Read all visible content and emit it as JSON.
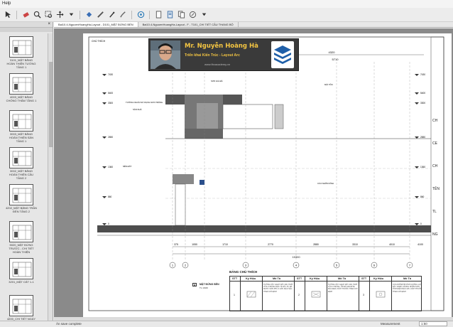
{
  "menu": {
    "help": "Help"
  },
  "sidebar": {
    "close": "×",
    "thumbs": [
      {
        "caption": "3101_MẶT BẰNG HOÀN THIỆN TƯỜNG TẦNG 1"
      },
      {
        "caption": "4003_MẶT BẰNG CHỐNG THẤM TẦNG 1"
      },
      {
        "caption": "3003_MẶT BẰNG HOÀN THIỆN SÀN TẦNG 1"
      },
      {
        "caption": "3002_MẶT BẰNG HOÀN THIỆN CẦU TẦNG 2"
      },
      {
        "caption": "4202_MẶT BẰNG TRẦN ĐÈN TẦNG 2"
      },
      {
        "caption": "5020_MẶT ĐỨNG TRƯỚC - CHI TIẾT HOÀN THIỆN"
      },
      {
        "caption": "3201_MẶT CẮT 1-1"
      },
      {
        "caption": "4200_CHI TIẾT NGÀY CỬA"
      }
    ]
  },
  "tabs": [
    {
      "label": "Bai10.4-NguoenHoangHa-Layout - D101_MẶT ĐỨNG BỂN"
    },
    {
      "label": "Bai10.4-NguoenHoangHa-Layout - F - T101_CHI TIẾT CẦU THANG BỘ"
    }
  ],
  "banner": {
    "name": "Mr. Nguyễn Hoàng Hà",
    "subtitle": "Triển khai Kiến Trúc - Layout Arc",
    "website": "www.fbcacademy.vn"
  },
  "drawing": {
    "sheet_label": "CHÚ THÍCH",
    "dims_top": [
      "4320",
      "5710"
    ],
    "dims_bottom": [
      "375",
      "1050",
      "1710",
      "2770",
      "2880",
      "3310",
      "4010",
      "4100"
    ],
    "dim_total": "15300",
    "elev_labels": [
      "7430",
      "5400",
      "3300",
      "2650",
      "1360",
      "860",
      "0"
    ],
    "axes_bottom": [
      "1",
      "2",
      "3",
      "4",
      "5",
      "6",
      "7"
    ],
    "tags": [
      "TƯỜNG NGOÀI SỬ DỤNG SƠN TRẮNG",
      "SÀN NHÀ",
      "NỀN ĐẤT",
      "MÁI TÔN",
      "CỬA NHÔM KÍNH",
      "SƠN GIẢ ĐÁ"
    ]
  },
  "legend": {
    "title": "BẢNG CHÚ THÍCH",
    "headers": [
      "STT",
      "Ký Hiệu",
      "Mô Tả",
      "STT",
      "Ký Hiệu",
      "Mô Tả",
      "STT",
      "Ký Hiệu",
      "Mô Tả"
    ],
    "rows": [
      {
        "stt": "1",
        "desc": "TƯỜNG XÂY GẠCH DÀY 200, TRÁT VỮA XI MĂNG MÁC 75 DÀY 15, BẢ MATIT, SƠN PHỦ 3 LỚP, MÀU SẮC THEO CHỈ ĐỊNH"
      },
      {
        "stt": "2",
        "desc": "TƯỜNG XÂY GẠCH DÀY 200, TRÁT VỮA XI MĂNG, ỐP ĐÁ GRANITE MÀU ĐEN, KÍCH THƯỚC THEO CHỈ ĐỊNH"
      },
      {
        "stt": "3",
        "desc": "CỬA NHÔM HỆ KÍNH CƯỜNG LỰC DÀY 10MM, KHUNG NHÔM SƠN TĨNH ĐIỆN MÀU GHI, KÍCH THƯỚC THEO CHỈ ĐỊNH"
      }
    ]
  },
  "material_key": {
    "letter": "A",
    "title": "MẶT ĐỨNG BỂN",
    "scale": "TL 1/100"
  },
  "title_block": {
    "letters": [
      "CH",
      "CE",
      "CH",
      "TÊN",
      "TL",
      "NG"
    ]
  },
  "status": {
    "left": "Ăn save complete",
    "right_label": "Measurement",
    "right_value": "1:50"
  }
}
